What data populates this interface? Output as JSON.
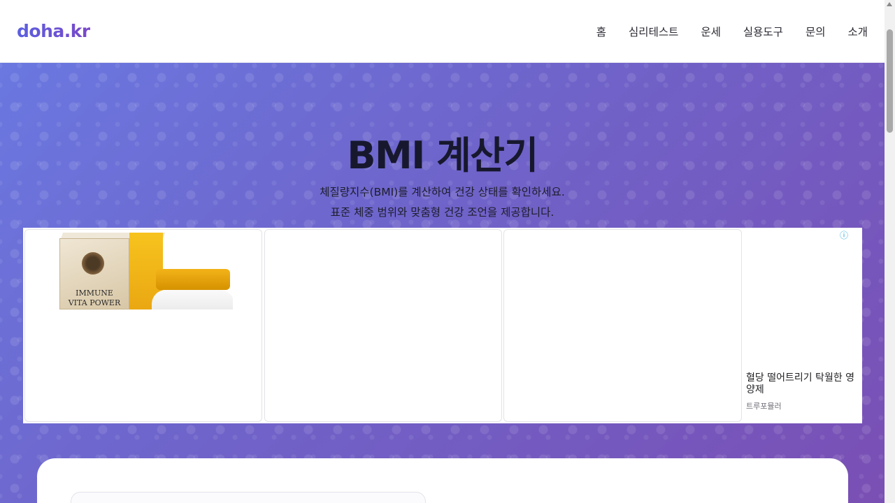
{
  "header": {
    "logo": "doha.kr",
    "nav": [
      "홈",
      "심리테스트",
      "운세",
      "실용도구",
      "문의",
      "소개"
    ]
  },
  "hero": {
    "title": "BMI 계산기",
    "subtitle_line1": "체질량지수(BMI)를 계산하여 건강 상태를 확인하세요.",
    "subtitle_line2": "표준 체중 범위와 맞춤형 건강 조언을 제공합니다."
  },
  "ad": {
    "info_icon": "ⓘ",
    "product_label": "IMMUNE\nVITA POWER",
    "headline": "혈당 떨어트리기 탁월한 영양제",
    "brand": "트루포뮬러"
  },
  "colors": {
    "hero_start": "#6a78e0",
    "hero_end": "#7a4fb4",
    "logo": "#5b5fe0",
    "ad_info": "#1a9ee0"
  }
}
